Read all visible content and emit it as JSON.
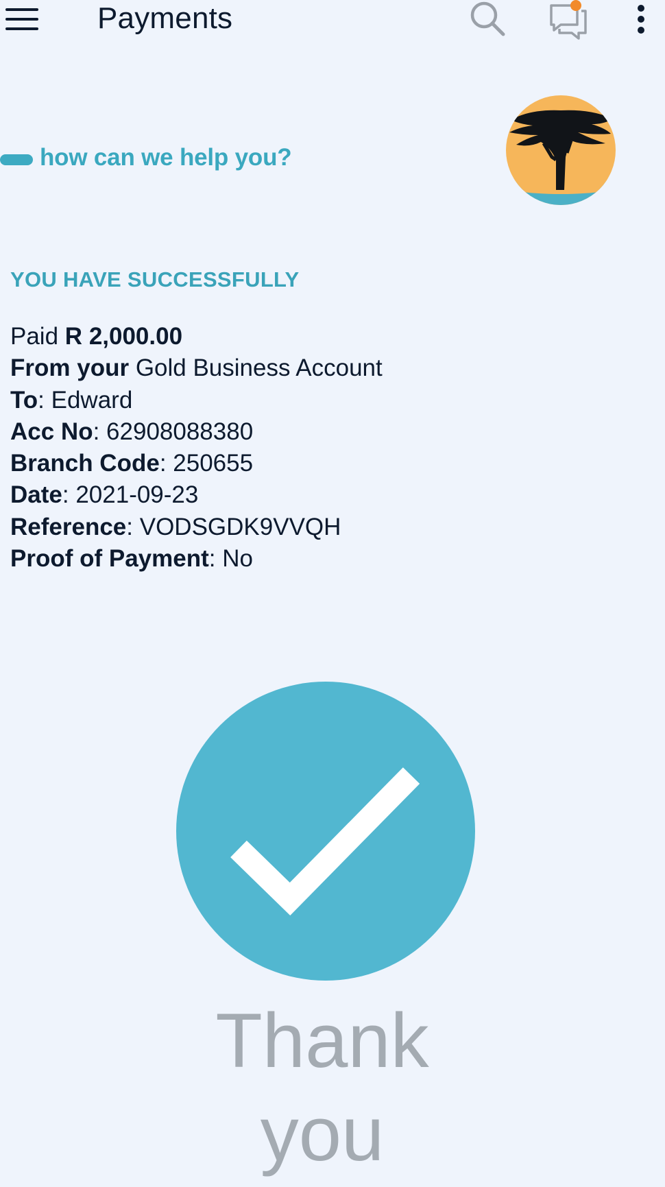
{
  "appbar": {
    "title": "Payments",
    "icons": [
      "menu-icon",
      "search-icon",
      "chat-icon",
      "more-vert-icon"
    ],
    "notification_dot_color": "#f28a2a"
  },
  "banner": {
    "help_text": "how can we help you?"
  },
  "colors": {
    "accent": "#3aa8bf",
    "check_circle": "#52b7d0",
    "logo_sun": "#f6b65a",
    "logo_wave": "#4bb0c6"
  },
  "confirmation": {
    "heading": "YOU HAVE SUCCESSFULLY",
    "paid_label": "Paid",
    "currency": "R",
    "amount": "2,000.00",
    "from_label": "From your",
    "from_value": "Gold Business Account",
    "to_label": "To",
    "to_value": "Edward",
    "acc_label": "Acc No",
    "acc_value": "62908088380",
    "branch_label": "Branch Code",
    "branch_value": "250655",
    "date_label": "Date",
    "date_value": "2021-09-23",
    "reference_label": "Reference",
    "reference_value": "VODSGDK9VVQH",
    "proof_label": "Proof of Payment",
    "proof_value": "No"
  },
  "footer": {
    "thank_line1": "Thank",
    "thank_line2": "you"
  }
}
